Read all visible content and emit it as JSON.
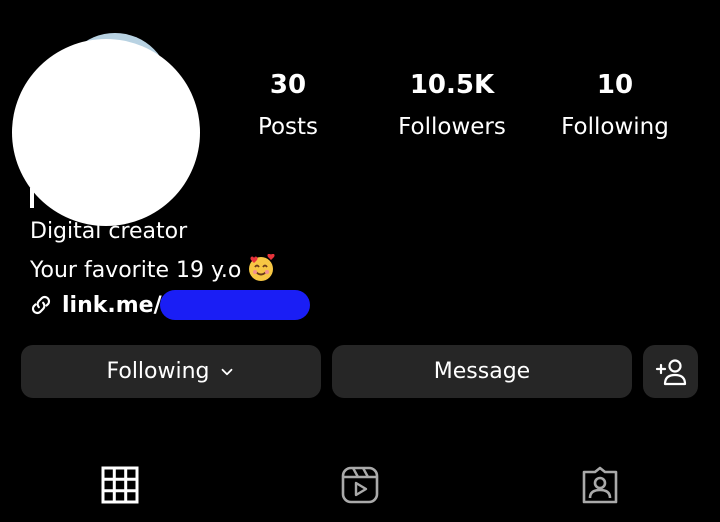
{
  "profile": {
    "stats": [
      {
        "count": "30",
        "label": "Posts"
      },
      {
        "count": "10.5K",
        "label": "Followers"
      },
      {
        "count": "10",
        "label": "Following"
      }
    ],
    "category": "Digital creator",
    "bio": "Your favorite 19 y.o",
    "bio_emoji": "smiling-face-with-hearts-emoji",
    "link": "link.me/"
  },
  "actions": {
    "following_label": "Following",
    "message_label": "Message",
    "add_person_icon": "add-person-icon"
  },
  "tabs": [
    {
      "icon": "grid-icon",
      "active": true
    },
    {
      "icon": "reels-icon",
      "active": false
    },
    {
      "icon": "tagged-icon",
      "active": false
    }
  ],
  "colors": {
    "background": "#000000",
    "button": "#262626",
    "text": "#ffffff",
    "redaction": "#1a1ef5"
  }
}
